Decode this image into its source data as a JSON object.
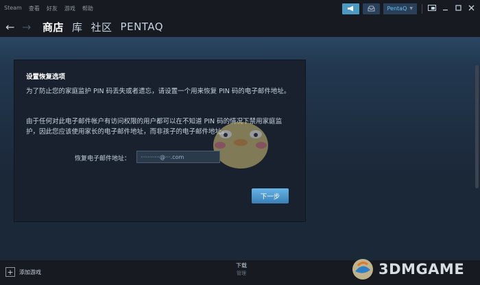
{
  "titlebar": {
    "menu": [
      "Steam",
      "查看",
      "好友",
      "游戏",
      "帮助"
    ],
    "user": "PentaQ",
    "window_controls": [
      "minimize-icon",
      "maximize-icon",
      "close-icon"
    ]
  },
  "nav": {
    "items": [
      "商店",
      "库",
      "社区",
      "PENTAQ"
    ],
    "active": "商店"
  },
  "dialog": {
    "title": "设置恢复选项",
    "para1": "为了防止您的家庭监护 PIN 码丢失或者遗忘，请设置一个用来恢复 PIN 码的电子邮件地址。",
    "para2": "由于任何对此电子邮件帐户有访问权限的用户都可以在不知道 PIN 码的情况下禁用家庭监护，因此您应该使用家长的电子邮件地址，而非孩子的电子邮件地址。",
    "email_label": "恢复电子邮件地址：",
    "email_value": "···········@···.com",
    "next_button": "下一步"
  },
  "bottombar": {
    "add_game": "添加游戏",
    "downloads": "下载",
    "downloads_sub": "管理"
  },
  "watermark": "3DMGAME",
  "colors": {
    "accent": "#4c9ac2",
    "link": "#66c0f4",
    "background": "#1b2838",
    "panel": "#18212d"
  }
}
